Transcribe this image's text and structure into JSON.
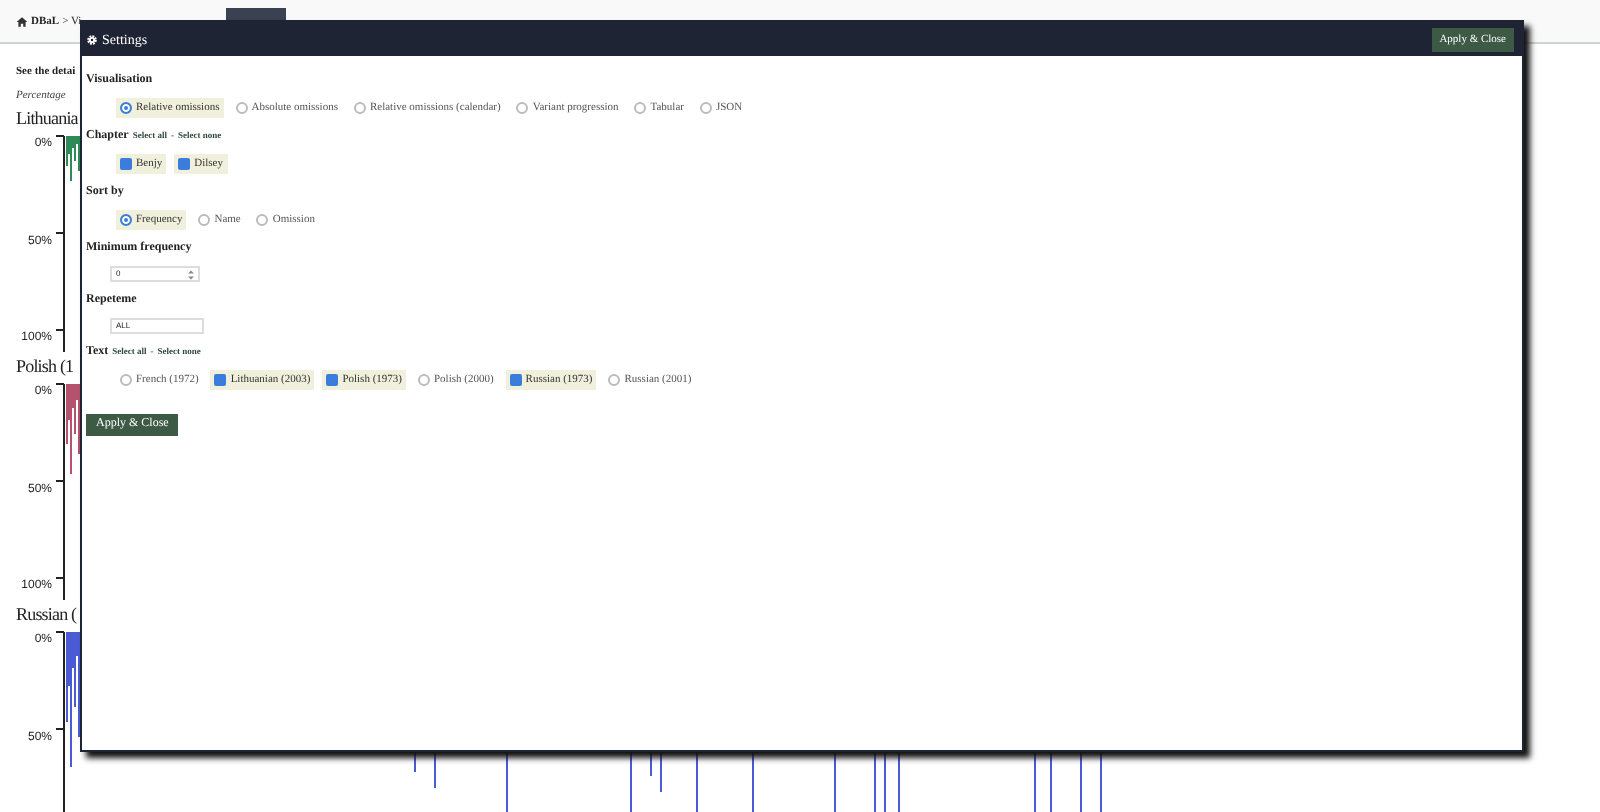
{
  "breadcrumb": {
    "home": "DBaL",
    "current": "> Vi"
  },
  "intro": {
    "heading": "See the detai",
    "note": "Percentage"
  },
  "charts": [
    {
      "title": "Lithuania",
      "color": "#2e8b57",
      "ticks": [
        "0%",
        "50%",
        "100%"
      ]
    },
    {
      "title": "Polish (1",
      "color": "#b5536f",
      "ticks": [
        "0%",
        "50%",
        "100%"
      ]
    },
    {
      "title": "Russian (",
      "color": "#4b5bd6",
      "ticks": [
        "0%",
        "50%"
      ]
    }
  ],
  "modal": {
    "title": "Settings",
    "header_button": "Apply & Close",
    "footer_button": "Apply & Close",
    "sections": [
      {
        "kind": "radio",
        "label": "Visualisation",
        "options": [
          {
            "label": "Relative omissions",
            "selected": true
          },
          {
            "label": "Absolute omissions",
            "selected": false
          },
          {
            "label": "Relative omissions (calendar)",
            "selected": false
          },
          {
            "label": "Variant progression",
            "selected": false
          },
          {
            "label": "Tabular",
            "selected": false
          },
          {
            "label": "JSON",
            "selected": false
          }
        ]
      },
      {
        "kind": "checkbox",
        "label": "Chapter",
        "links": [
          "Select all",
          "Select none"
        ],
        "separator": "-",
        "options": [
          {
            "label": "Benjy",
            "checked": true
          },
          {
            "label": "Dilsey",
            "checked": true
          }
        ]
      },
      {
        "kind": "radio",
        "label": "Sort by",
        "options": [
          {
            "label": "Frequency",
            "selected": true
          },
          {
            "label": "Name",
            "selected": false
          },
          {
            "label": "Omission",
            "selected": false
          }
        ]
      },
      {
        "kind": "number",
        "label": "Minimum frequency",
        "value": "0"
      },
      {
        "kind": "text",
        "label": "Repeteme",
        "value": "ALL"
      },
      {
        "kind": "checkbox",
        "label": "Text",
        "links": [
          "Select all",
          "Select none"
        ],
        "separator": "-",
        "options": [
          {
            "label": "French (1972)",
            "checked": false
          },
          {
            "label": "Lithuanian (2003)",
            "checked": true
          },
          {
            "label": "Polish (1973)",
            "checked": true
          },
          {
            "label": "Polish (2000)",
            "checked": false
          },
          {
            "label": "Russian (1973)",
            "checked": true
          },
          {
            "label": "Russian (2001)",
            "checked": false
          }
        ]
      }
    ]
  }
}
